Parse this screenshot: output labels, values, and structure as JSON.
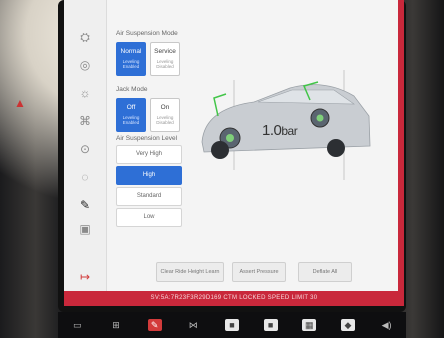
{
  "air_suspension_mode": {
    "title": "Air Suspension Mode",
    "options": [
      {
        "label": "Normal",
        "sub": "Leveling Enabled",
        "selected": true
      },
      {
        "label": "Service",
        "sub": "Leveling Disabled",
        "selected": false
      }
    ]
  },
  "jack_mode": {
    "title": "Jack Mode",
    "options": [
      {
        "label": "Off",
        "sub": "Leveling Enabled",
        "selected": true
      },
      {
        "label": "On",
        "sub": "Leveling Disabled",
        "selected": false
      }
    ]
  },
  "ride_height": {
    "title": "Air Suspension Level",
    "options": [
      "Very High",
      "High",
      "Standard",
      "Low"
    ],
    "selected": "High"
  },
  "car": {
    "pressure_value": "1.0",
    "pressure_unit": "bar"
  },
  "buttons": {
    "clear_ride_height_learn": "Clear Ride Height Learn",
    "assert_pressure": "Assert Pressure",
    "deflate_all": "Deflate All"
  },
  "status_bar": "SV:5A:7R23F3R29D169 CTM LOCKED SPEED LIMIT 30",
  "colors": {
    "accent": "#2e6fd6",
    "status_bar": "#c9283b",
    "wheel_marker": "#42c548"
  }
}
